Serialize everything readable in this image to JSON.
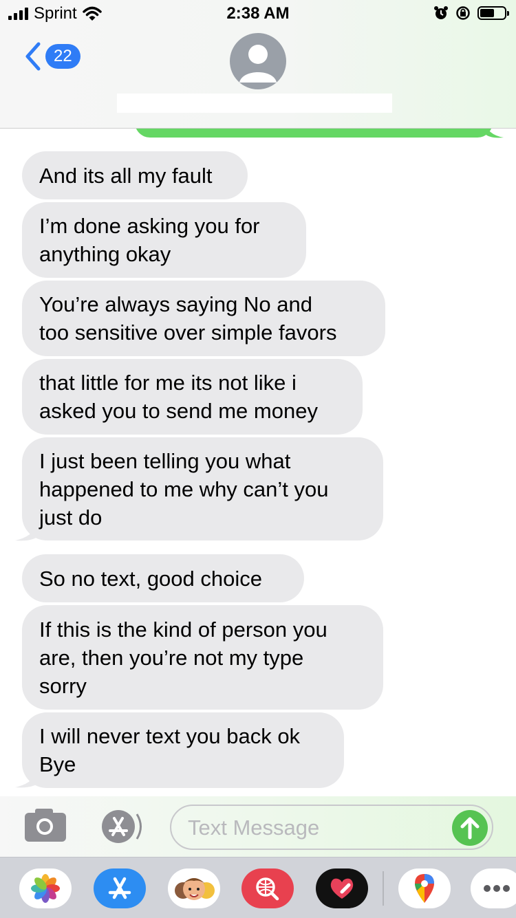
{
  "status_bar": {
    "carrier": "Sprint",
    "time": "2:38 AM",
    "battery_level": 0.6
  },
  "header": {
    "back_count": "22",
    "back_icon": "chevron-left-icon",
    "avatar_icon": "person-icon"
  },
  "messages": [
    {
      "text": "And its all my fault",
      "direction": "received"
    },
    {
      "text": "I’m done asking you for\nanything okay",
      "direction": "received"
    },
    {
      "text": "You’re always saying No and\ntoo sensitive over simple favors",
      "direction": "received"
    },
    {
      "text": "that little for me its not like i\nasked you to send me money",
      "direction": "received"
    },
    {
      "text": "I just been telling you what\nhappened to me why can’t you\njust do",
      "direction": "received"
    },
    {
      "text": "So no text, good choice",
      "direction": "received"
    },
    {
      "text": "If this is the kind of person you\nare, then you’re not my type\nsorry",
      "direction": "received"
    },
    {
      "text": "I will never text you back ok\nBye",
      "direction": "received"
    }
  ],
  "composer": {
    "placeholder": "Text Message",
    "camera_icon": "camera-icon",
    "appstore_icon": "app-store-icon",
    "send_icon": "arrow-up-icon"
  },
  "app_drawer": {
    "apps": [
      "photos-icon",
      "app-store-icon",
      "memoji-icon",
      "web-search-icon",
      "digital-touch-icon",
      "google-maps-icon",
      "more-icon"
    ]
  },
  "colors": {
    "ios_blue": "#2f7cf6",
    "sent_green": "#65d764",
    "received_gray": "#e9e9eb",
    "send_button_green": "#56c352"
  }
}
